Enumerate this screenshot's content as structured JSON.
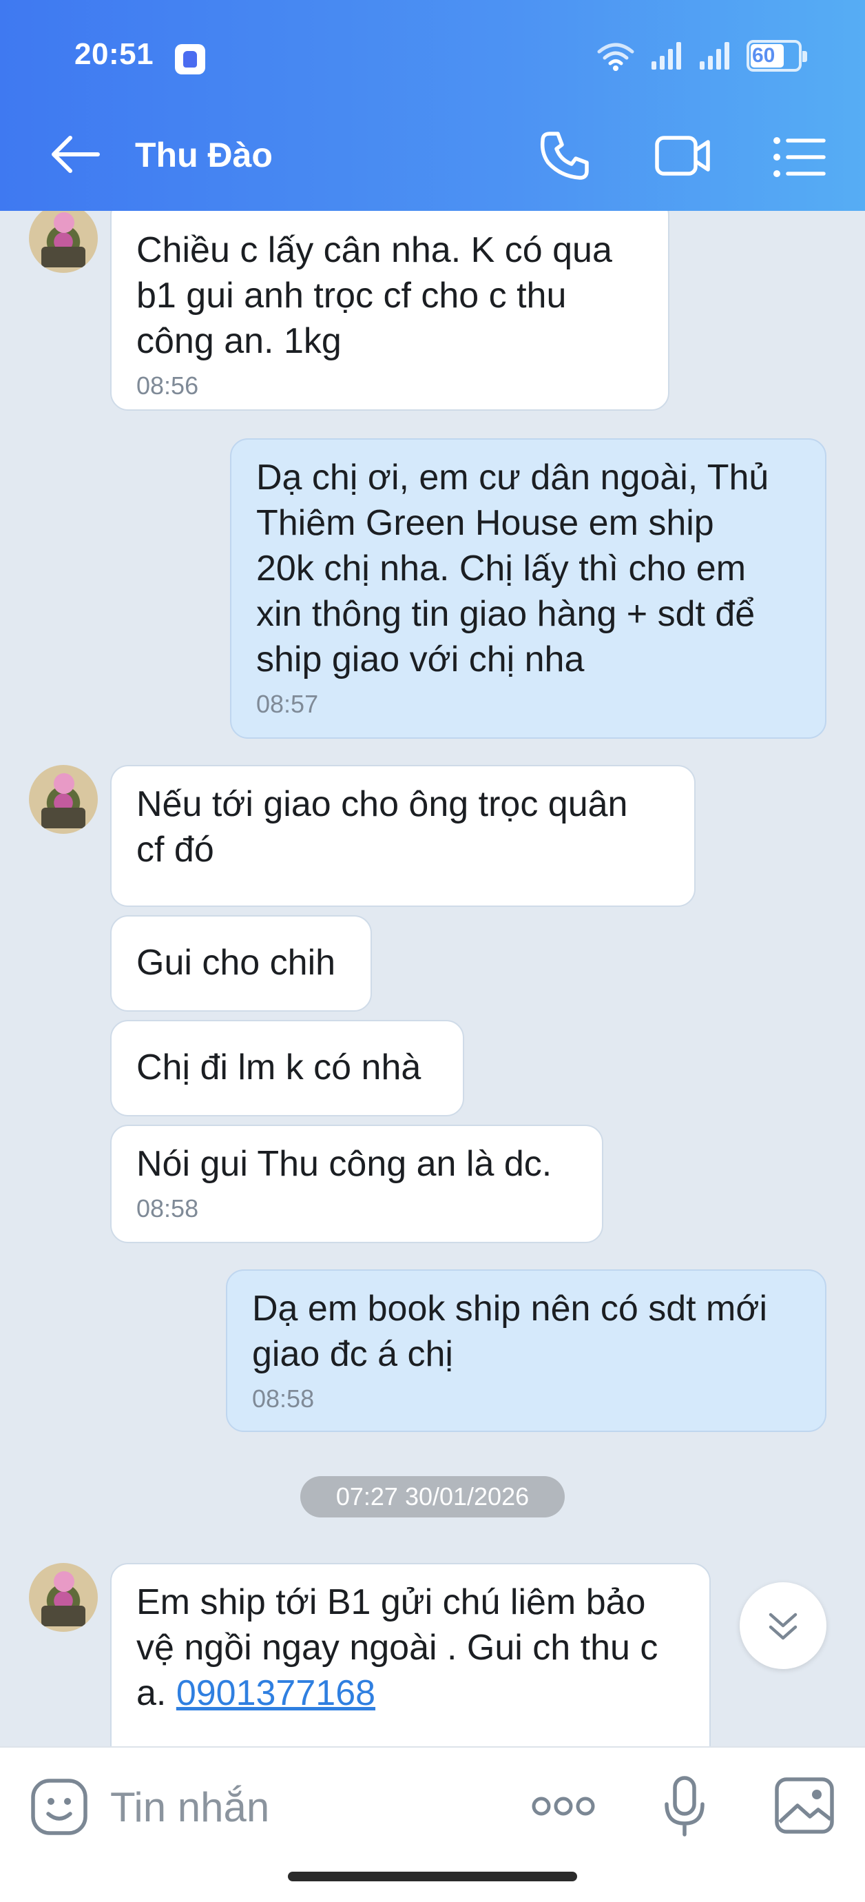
{
  "status_bar": {
    "time": "20:51",
    "battery": "60"
  },
  "header": {
    "contact_name": "Thu Đào",
    "back_icon": "arrow-left-icon",
    "call_icon": "phone-icon",
    "video_icon": "video-camera-icon",
    "menu_icon": "list-menu-icon"
  },
  "messages": [
    {
      "direction": "in",
      "text": "Chiều c lấy cân nha. K có qua\nb1 gui anh trọc cf cho c thu\ncông an. 1kg",
      "time": "08:56"
    },
    {
      "direction": "out",
      "text": "Dạ chị ơi, em cư dân ngoài, Thủ\nThiêm Green House em ship\n20k chị nha. Chị lấy thì cho em\nxin thông tin giao hàng + sdt để\nship giao với chị nha",
      "time": "08:57"
    },
    {
      "direction": "in",
      "text": "Nếu tới giao cho ông trọc quân\ncf đó"
    },
    {
      "direction": "in",
      "text": "Gui cho chih"
    },
    {
      "direction": "in",
      "text": "Chị đi lm k có nhà"
    },
    {
      "direction": "in",
      "text": "Nói gui Thu công an là dc.",
      "time": "08:58"
    },
    {
      "direction": "out",
      "text": "Dạ em book ship nên có sdt mới\ngiao đc á chị",
      "time": "08:58"
    },
    {
      "direction": "in",
      "text": "Em ship tới B1 gửi chú liêm bảo\nvệ ngồi ngay ngoài . Gui ch thu c\na. ",
      "phone": "0901377168"
    }
  ],
  "date_separator": "07:27 30/01/2026",
  "input": {
    "placeholder": "Tin nhắn",
    "value": ""
  },
  "colors": {
    "header_start": "#3f79f1",
    "header_end": "#56adf4",
    "chat_background": "#e2e9f1",
    "outgoing_bubble": "#d5e9fb",
    "incoming_bubble": "#ffffff",
    "link": "#2f7fe0"
  }
}
